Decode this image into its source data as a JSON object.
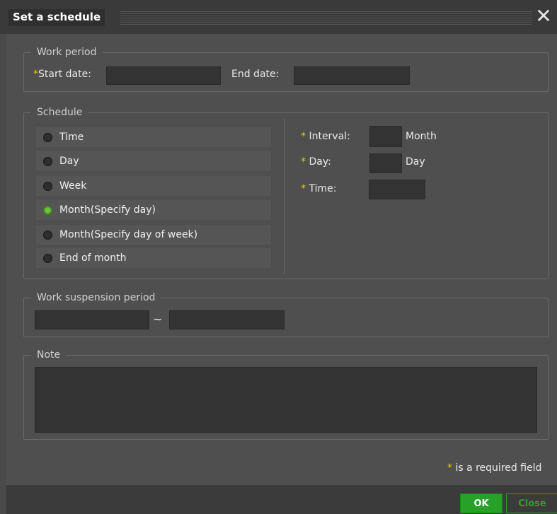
{
  "dialog": {
    "title": "Set a schedule",
    "close_symbol": "✕"
  },
  "work_period": {
    "legend": "Work period",
    "required_mark": "*",
    "start_label": "Start date:",
    "start_value": "",
    "end_label": "End date:",
    "end_value": ""
  },
  "schedule": {
    "legend": "Schedule",
    "options": [
      {
        "label": "Time",
        "selected": false
      },
      {
        "label": "Day",
        "selected": false
      },
      {
        "label": "Week",
        "selected": false
      },
      {
        "label": "Month(Specify day)",
        "selected": true
      },
      {
        "label": "Month(Specify day of week)",
        "selected": false
      },
      {
        "label": "End of month",
        "selected": false
      }
    ],
    "interval_label": "Interval:",
    "interval_unit": "Month",
    "interval_value": "",
    "day_label": "Day:",
    "day_unit": "Day",
    "day_value": "",
    "time_label": "Time:",
    "time_value": ""
  },
  "suspension": {
    "legend": "Work suspension period",
    "tilde": "~",
    "from_value": "",
    "to_value": ""
  },
  "note": {
    "legend": "Note",
    "value": ""
  },
  "required_note": {
    "mark": "*",
    "text": " is a required field"
  },
  "footer": {
    "ok_label": "OK",
    "close_label": "Close"
  },
  "colors": {
    "accent_green": "#27a127",
    "required_yellow": "#e3d000"
  }
}
